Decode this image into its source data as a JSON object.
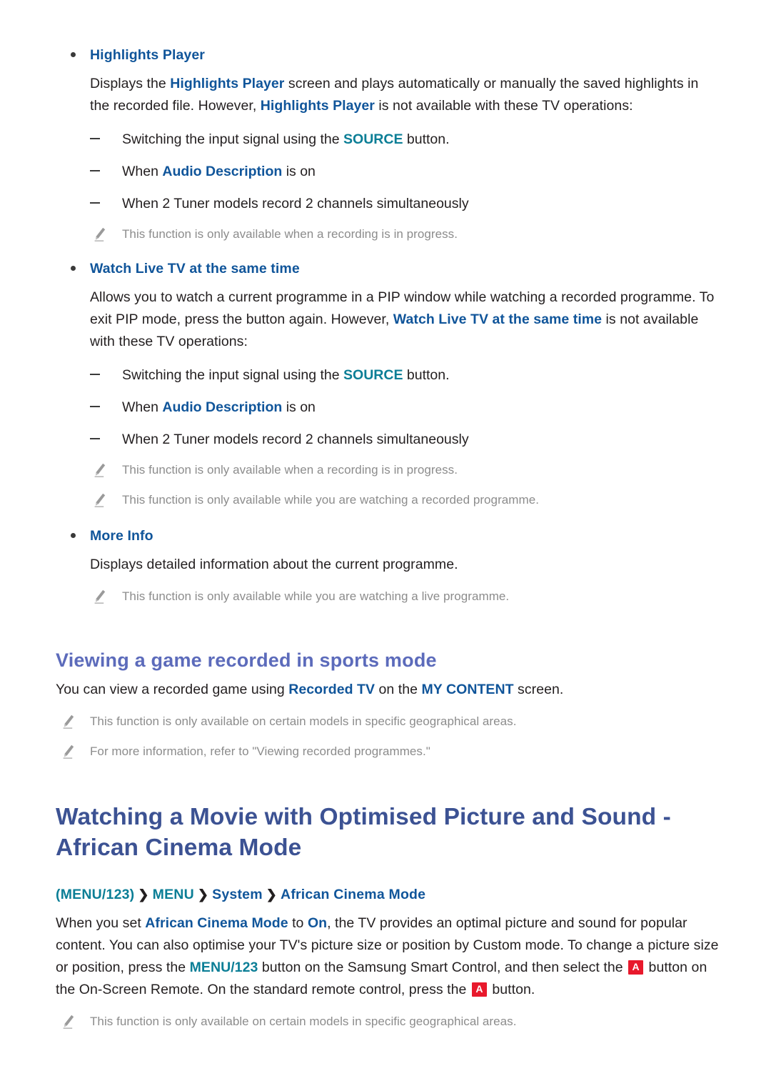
{
  "colors": {
    "keyword_blue": "#10559a",
    "keyword_teal": "#0b7e96",
    "heading_sub": "#5c6bbb",
    "heading_main": "#3c5293",
    "note_gray": "#8c8c8c",
    "key_badge_red": "#e8192c",
    "body_text": "#231f20"
  },
  "sections": {
    "highlights_player": {
      "bullet_label": "Highlights Player",
      "paragraph": {
        "p1": "Displays the ",
        "kw1": "Highlights Player",
        "p2": " screen and plays automatically or manually the saved highlights in the recorded file. However, ",
        "kw2": "Highlights Player",
        "p3": " is not available with these TV operations:"
      },
      "sub_items": [
        {
          "pre": "Switching the input signal using the ",
          "kw": "SOURCE",
          "post": " button."
        },
        {
          "pre": "When ",
          "kw": "Audio Description",
          "post": " is on"
        },
        {
          "pre": "When 2 Tuner models record 2 channels simultaneously",
          "kw": "",
          "post": ""
        }
      ],
      "notes": [
        "This function is only available when a recording is in progress."
      ]
    },
    "watch_live_tv": {
      "bullet_label": "Watch Live TV at the same time",
      "paragraph": {
        "p1": "Allows you to watch a current programme in a PIP window while watching a recorded programme. To exit PIP mode, press the button again. However, ",
        "kw1": "Watch Live TV at the same time",
        "p2": " is not available with these TV operations:"
      },
      "sub_items": [
        {
          "pre": "Switching the input signal using the ",
          "kw": "SOURCE",
          "post": " button."
        },
        {
          "pre": "When ",
          "kw": "Audio Description",
          "post": " is on"
        },
        {
          "pre": "When 2 Tuner models record 2 channels simultaneously",
          "kw": "",
          "post": ""
        }
      ],
      "notes": [
        "This function is only available when a recording is in progress.",
        "This function is only available while you are watching a recorded programme."
      ]
    },
    "more_info": {
      "bullet_label": "More Info",
      "paragraph": "Displays detailed information about the current programme.",
      "notes": [
        "This function is only available while you are watching a live programme."
      ]
    },
    "sports_mode": {
      "heading": "Viewing a game recorded in sports mode",
      "paragraph": {
        "p1": "You can view a recorded game using ",
        "kw1": "Recorded TV",
        "p2": " on the ",
        "kw2": "MY CONTENT",
        "p3": " screen."
      },
      "notes": [
        "This function is only available on certain models in specific geographical areas.",
        "For more information, refer to \"Viewing recorded programmes.\""
      ]
    },
    "african_cinema": {
      "heading_line1": "Watching a Movie with Optimised Picture and Sound -",
      "heading_line2": "African Cinema Mode",
      "menu_path": {
        "item1": "(MENU/123)",
        "arrow1": "❯",
        "item2": "MENU",
        "arrow2": "❯",
        "item3": "System",
        "arrow3": "❯",
        "item4": "African Cinema Mode"
      },
      "paragraph": {
        "p1": "When you set ",
        "kw1": "African Cinema Mode",
        "p2": " to ",
        "kw2": "On",
        "p3": ", the TV provides an optimal picture and sound for popular content. You can also optimise your TV's picture size or position by Custom mode. To change a picture size or position, press the ",
        "kw3": "MENU/123",
        "p4": " button on the Samsung Smart Control, and then select the ",
        "key1": "A",
        "p5": " button on the On-Screen Remote. On the standard remote control, press the ",
        "key2": "A",
        "p6": " button."
      },
      "notes": [
        "This function is only available on certain models in specific geographical areas."
      ]
    }
  }
}
